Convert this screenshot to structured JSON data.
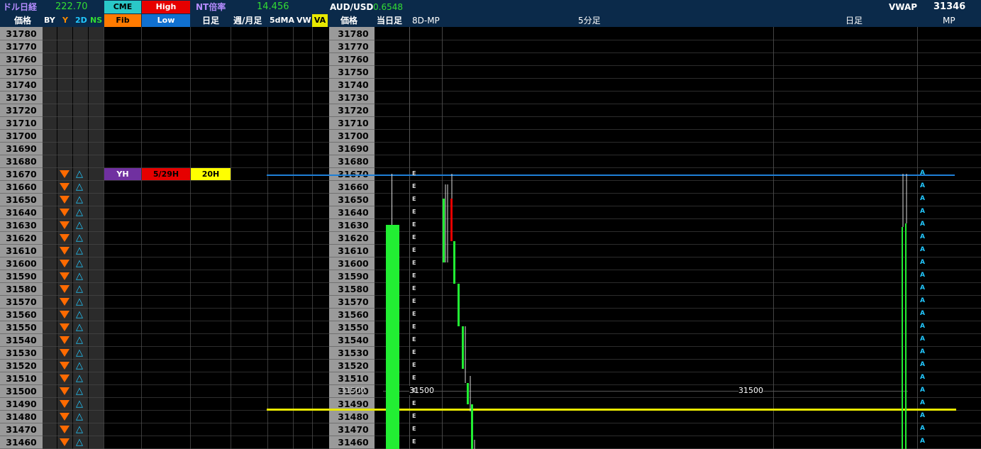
{
  "header_row1": {
    "dollar_nikkei_label": "ドル日経",
    "dollar_nikkei_value": "222.70",
    "cme_label": "CME",
    "high_label": "High",
    "nt_ratio_label": "NT倍率",
    "nt_ratio_value": "14.456",
    "audusd_label": "AUD/USD",
    "audusd_value": "0.6548",
    "vwap_label": "VWAP",
    "vwap_value": "31346"
  },
  "header_row2": {
    "price_label": "価格",
    "by_label": "BY",
    "y_label": "Y",
    "twod_label": "2D",
    "ns_label": "NS",
    "fib_label": "Fib",
    "low_label": "Low",
    "daily_label": "日足",
    "weekly_monthly_label": "週/月足",
    "fivedma_label": "5dMA",
    "vw_label": "VW",
    "va_label": "VA",
    "price2_label": "価格",
    "today_label": "当日足",
    "eightd_mp_label": "8D-MP",
    "five_min_label": "5分足",
    "daily2_label": "日足",
    "mp_label": "MP"
  },
  "prices": [
    "31780",
    "31770",
    "31760",
    "31750",
    "31740",
    "31730",
    "31720",
    "31710",
    "31700",
    "31690",
    "31680",
    "31670",
    "31660",
    "31650",
    "31640",
    "31630",
    "31620",
    "31610",
    "31600",
    "31590",
    "31580",
    "31570",
    "31560",
    "31550",
    "31540",
    "31530",
    "31520",
    "31510",
    "31500",
    "31490",
    "31480",
    "31470",
    "31460"
  ],
  "markers": {
    "yh": "YH",
    "h529": "5/29H",
    "h20": "20H"
  },
  "level_labels": {
    "l1": "31500",
    "l2": "31500",
    "l3": "31500"
  },
  "colors": {
    "header_bg": "#0b2a4a",
    "price_col": "#9a9a9a",
    "blue_line": "#1e7fd6",
    "yellow_line": "#e8e800",
    "candle_green": "#22ee33",
    "arrow_orange": "#ff6a00",
    "arrow_cyan": "#22c8ff"
  }
}
